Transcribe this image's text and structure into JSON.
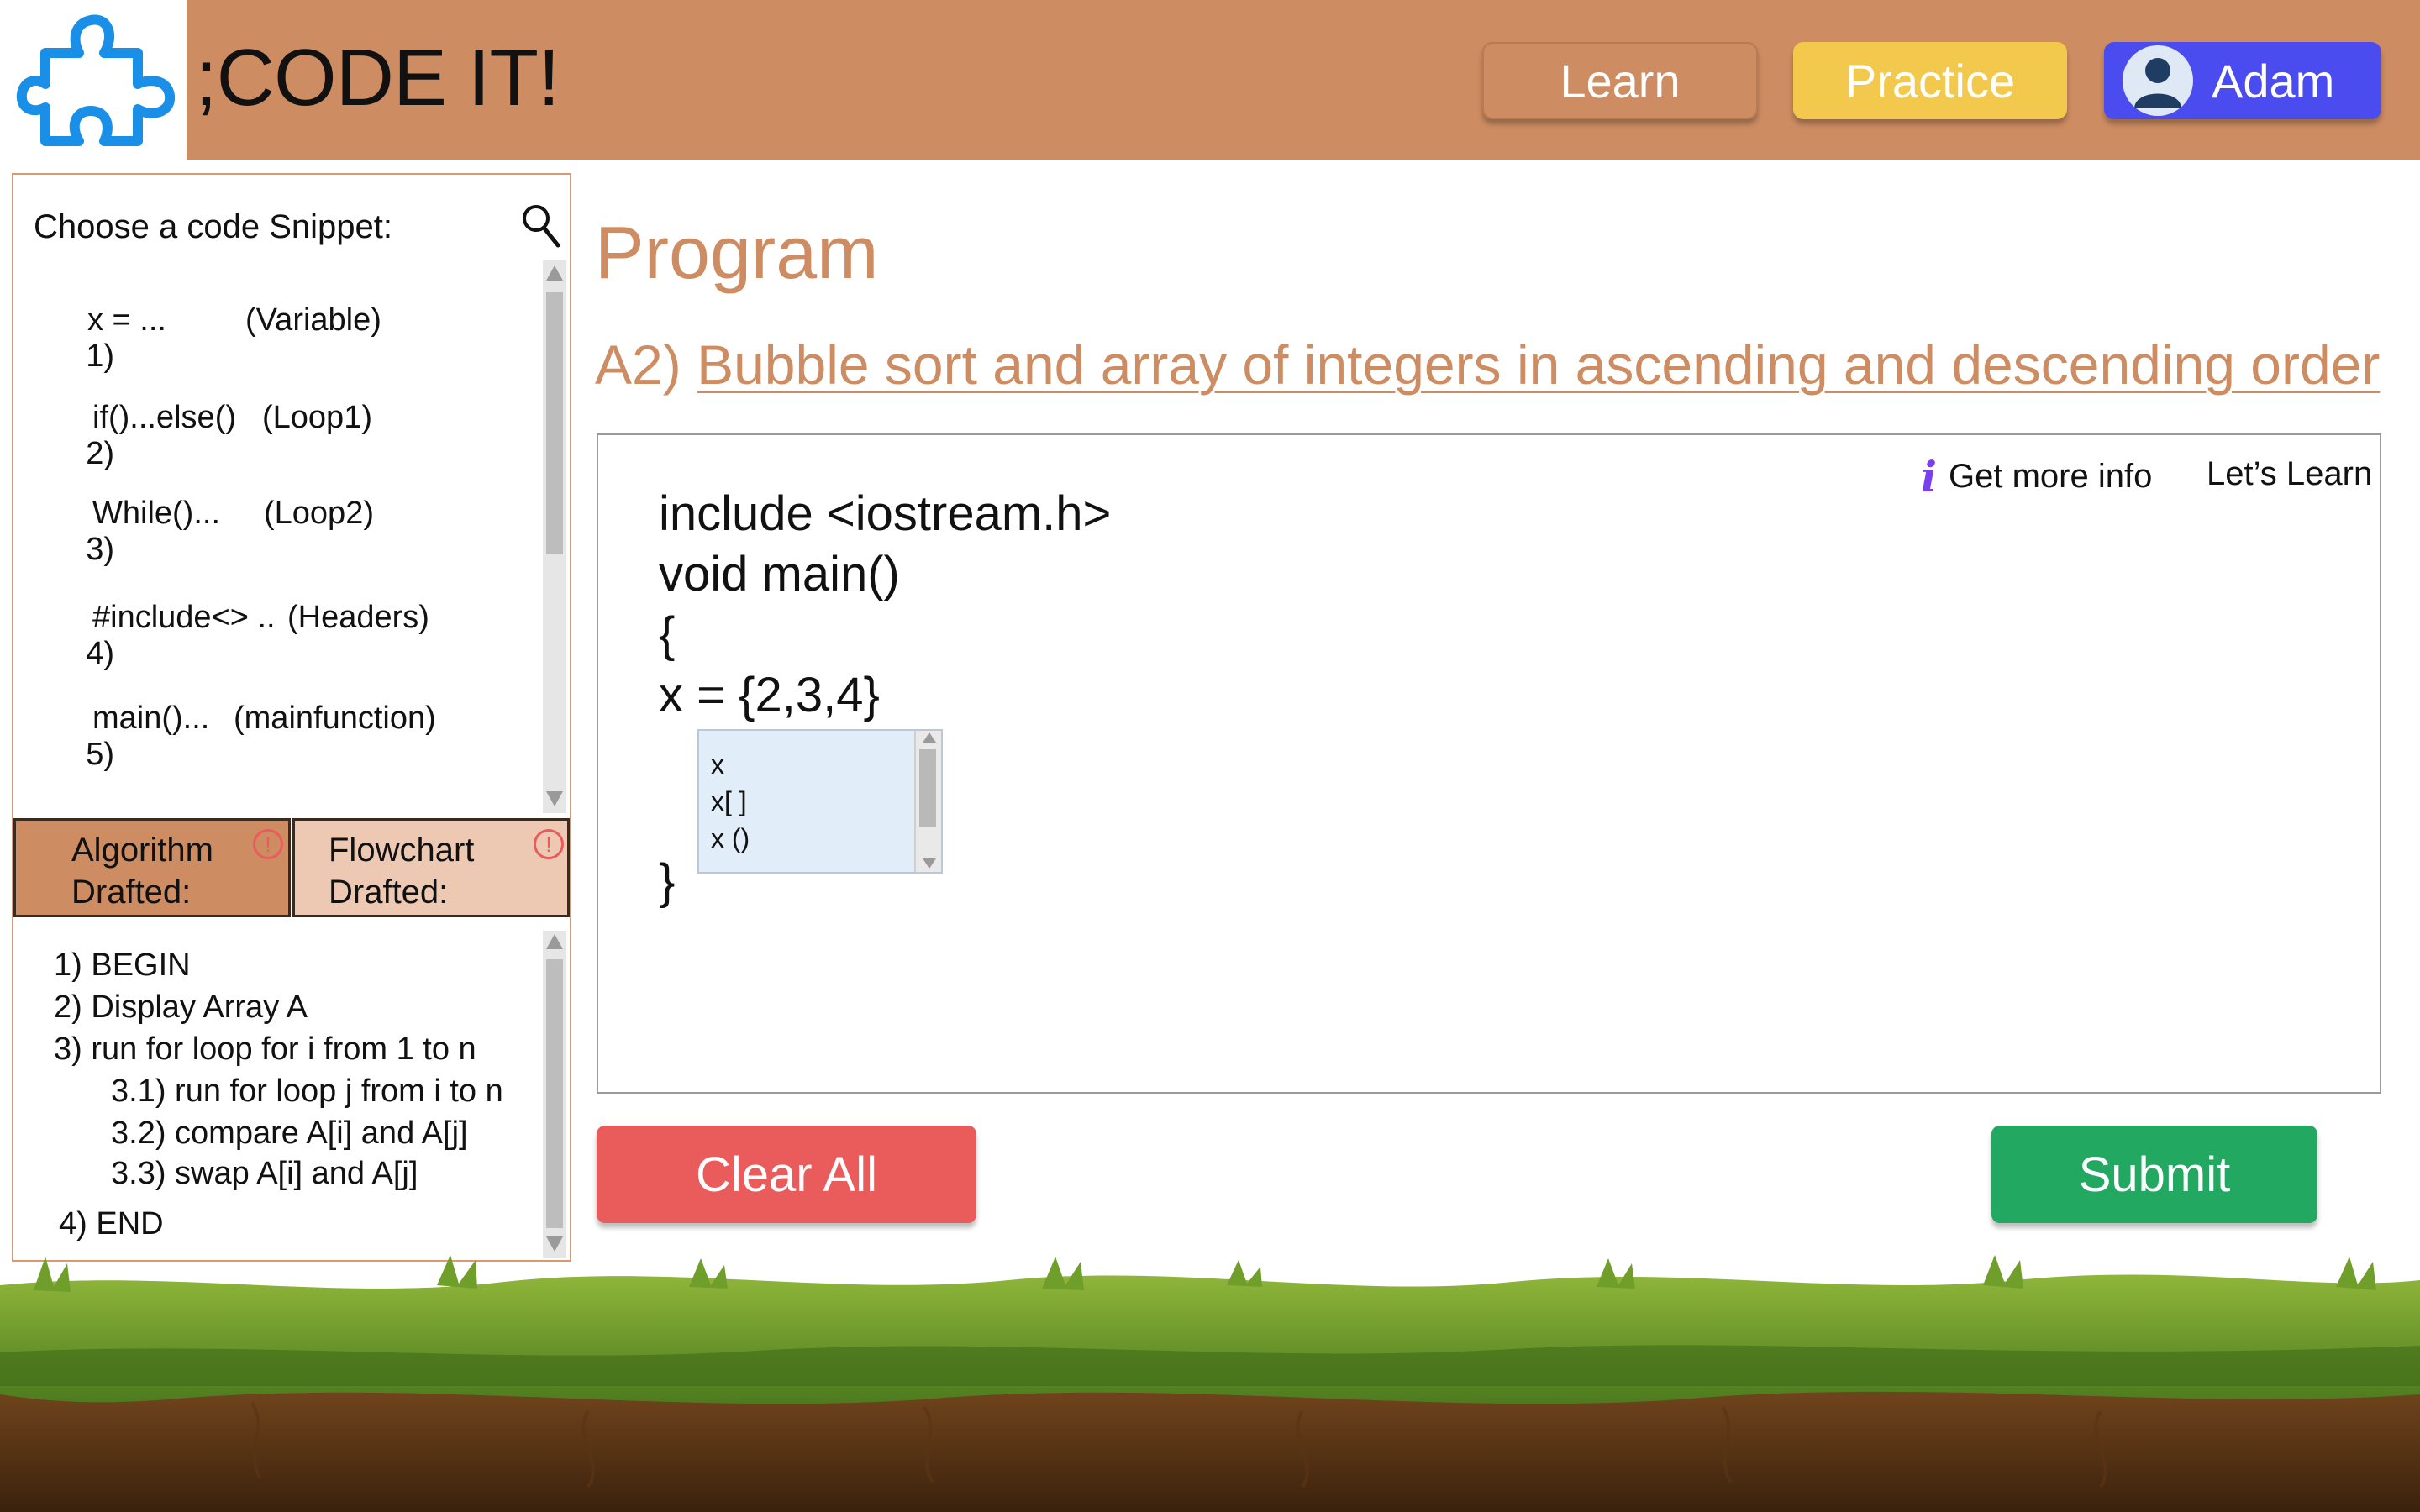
{
  "header": {
    "brand": ";CODE IT!",
    "nav": {
      "learn": "Learn",
      "practice": "Practice",
      "user": "Adam"
    },
    "colors": {
      "bar": "#cd8c62",
      "practice": "#f2c94c",
      "profile": "#4b4cf0",
      "logo": "#1a8fe8"
    }
  },
  "sidebar": {
    "snippet_title": "Choose a code Snippet:",
    "snippets": [
      {
        "num": "1)",
        "code": "x = ...",
        "kind": "(Variable)"
      },
      {
        "num": "2)",
        "code": "if()...else()",
        "kind": "(Loop1)"
      },
      {
        "num": "3)",
        "code": "While()...",
        "kind": "(Loop2)"
      },
      {
        "num": "4)",
        "code": "#include<> ..",
        "kind": "(Headers)"
      },
      {
        "num": "5)",
        "code": "main()...",
        "kind": "(mainfunction)"
      }
    ],
    "tabs": [
      {
        "line1": "Algorithm",
        "line2": "Drafted:"
      },
      {
        "line1": "Flowchart",
        "line2": "Drafted:"
      }
    ],
    "warn_symbol": "!",
    "algorithm": [
      "1) BEGIN",
      "2) Display Array A",
      "3) run for loop for i from 1 to n",
      "3.1) run for loop j from i to n",
      "3.2) compare A[i] and A[j]",
      "3.3) swap A[i] and A[j]",
      "4) END"
    ]
  },
  "main": {
    "title": "Program",
    "question_prefix": "A2)",
    "question_text": "Bubble sort and array of integers in ascending and descending order",
    "info_icon": "i",
    "info_label": "Get more info",
    "lets_learn": "Let’s Learn",
    "code_lines": [
      "include <iostream.h>",
      "void main()",
      "{",
      "x = {2,3,4}",
      "}"
    ],
    "autocomplete": [
      "x",
      "x[ ]",
      "x ()"
    ],
    "clear_label": "Clear All",
    "submit_label": "Submit",
    "colors": {
      "accent": "#cd8c62",
      "clear": "#ea5c5c",
      "submit": "#22a861"
    }
  }
}
